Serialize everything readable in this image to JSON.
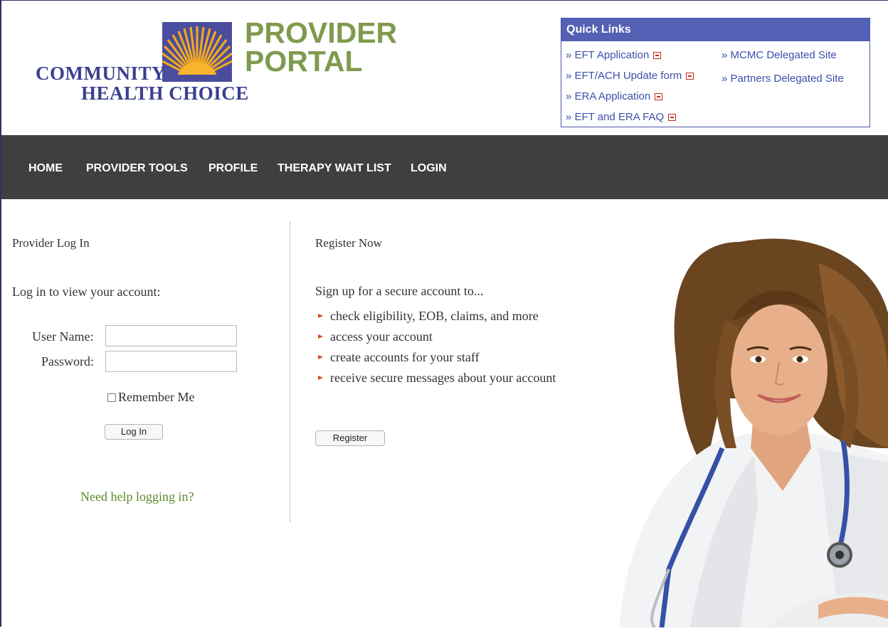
{
  "logo": {
    "line1": "COMMUNITY",
    "line2": "HEALTH CHOICE"
  },
  "portal_title": {
    "line1": "PROVIDER",
    "line2": "PORTAL"
  },
  "quick_links": {
    "title": "Quick Links",
    "left": [
      "» EFT Application",
      "» EFT/ACH Update form",
      "» ERA Application",
      "» EFT and ERA FAQ"
    ],
    "right": [
      "» MCMC Delegated Site",
      "» Partners Delegated Site"
    ]
  },
  "nav": [
    "HOME",
    "PROVIDER TOOLS",
    "PROFILE",
    "THERAPY WAIT LIST",
    "LOGIN"
  ],
  "login": {
    "heading": "Provider Log In",
    "intro": "Log in to view your account:",
    "username_label": "User Name:",
    "username_value": "",
    "password_label": "Password:",
    "password_value": "",
    "remember_label": "Remember Me",
    "button": "Log In",
    "help_link": "Need help logging in?"
  },
  "register": {
    "heading": "Register Now",
    "intro": "Sign up for a secure account to...",
    "bullets": [
      "check eligibility, EOB, claims, and more",
      "access your account",
      "create accounts for your staff",
      "receive secure messages about your account"
    ],
    "button": "Register"
  },
  "colors": {
    "nav_bg": "#3f3f3f",
    "quick_links_header": "#5360b4",
    "link_blue": "#3d4fa8",
    "portal_green": "#7f9a4e",
    "help_green": "#5b8a2a",
    "bullet_arrow": "#d44a1f",
    "logo_navy": "#3b3f8f",
    "sun_orange": "#f2a81d"
  }
}
